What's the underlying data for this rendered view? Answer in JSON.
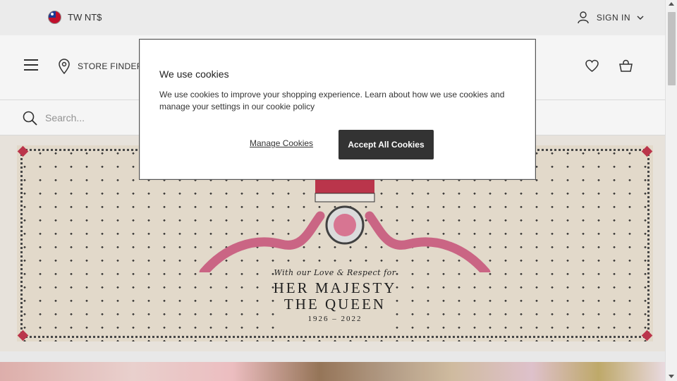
{
  "topbar": {
    "locale_label": "TW NT$",
    "sign_in_label": "SIGN IN"
  },
  "header": {
    "store_finder_label": "STORE FINDER"
  },
  "search": {
    "placeholder": "Search..."
  },
  "hero": {
    "tagline": "With our Love & Respect for",
    "title_line1": "HER MAJESTY",
    "title_line2": "THE QUEEN",
    "years": "1926 – 2022"
  },
  "cookie_dialog": {
    "title": "We use cookies",
    "body": "We use cookies to improve your shopping experience. Learn about how we use cookies and manage your settings in our cookie policy",
    "manage_label": "Manage Cookies",
    "accept_label": "Accept All Cookies"
  },
  "colors": {
    "accent_dark": "#333333",
    "banner_pink": "#c2384f"
  },
  "icons": {
    "flag": "taiwan-flag-icon",
    "user": "user-icon",
    "chevron": "chevron-down-icon",
    "menu": "hamburger-menu-icon",
    "pin": "location-pin-icon",
    "heart": "heart-icon",
    "bag": "shopping-bag-icon",
    "search": "search-icon"
  }
}
